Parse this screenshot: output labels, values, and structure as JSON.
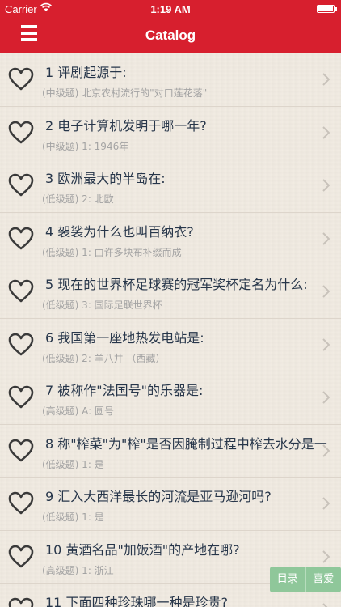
{
  "status_bar": {
    "carrier": "Carrier",
    "time": "1:19 AM"
  },
  "nav": {
    "title": "Catalog",
    "menu_icon": "hamburger-menu-icon"
  },
  "colors": {
    "bar": "#d71f2e",
    "question_text": "#27364a",
    "answer_text": "#a3a3a3",
    "float_button": "#8fc79a"
  },
  "items": [
    {
      "question": "1 评剧起源于:",
      "answer": "(中级题) 北京农村流行的\"对口莲花落\""
    },
    {
      "question": "2 电子计算机发明于哪一年?",
      "answer": "(中级题) 1: 1946年"
    },
    {
      "question": "3 欧洲最大的半岛在:",
      "answer": "(低级题) 2: 北欧"
    },
    {
      "question": "4 袈裟为什么也叫百纳衣?",
      "answer": "(低级题) 1: 由许多块布补缀而成"
    },
    {
      "question": "5 现在的世界杯足球赛的冠军奖杯定名为什么:",
      "answer": "(低级题) 3: 国际足联世界杯"
    },
    {
      "question": "6 我国第一座地热发电站是:",
      "answer": "(低级题) 2: 羊八井 （西藏）"
    },
    {
      "question": "7 被称作\"法国号\"的乐器是:",
      "answer": "(高级题) A: 圆号"
    },
    {
      "question": "8 称\"榨菜\"为\"榨\"是否因腌制过程中榨去水分是一",
      "answer": "(低级题) 1: 是"
    },
    {
      "question": "9 汇入大西洋最长的河流是亚马逊河吗?",
      "answer": "(低级题) 1: 是"
    },
    {
      "question": "10 黄酒名品\"加饭酒\"的产地在哪?",
      "answer": "(高级题) 1: 浙江"
    },
    {
      "question": "11 下面四种珍珠哪一种是珍贵?",
      "answer": ""
    }
  ],
  "float_buttons": {
    "catalog": "目录",
    "favorites": "喜爱"
  }
}
